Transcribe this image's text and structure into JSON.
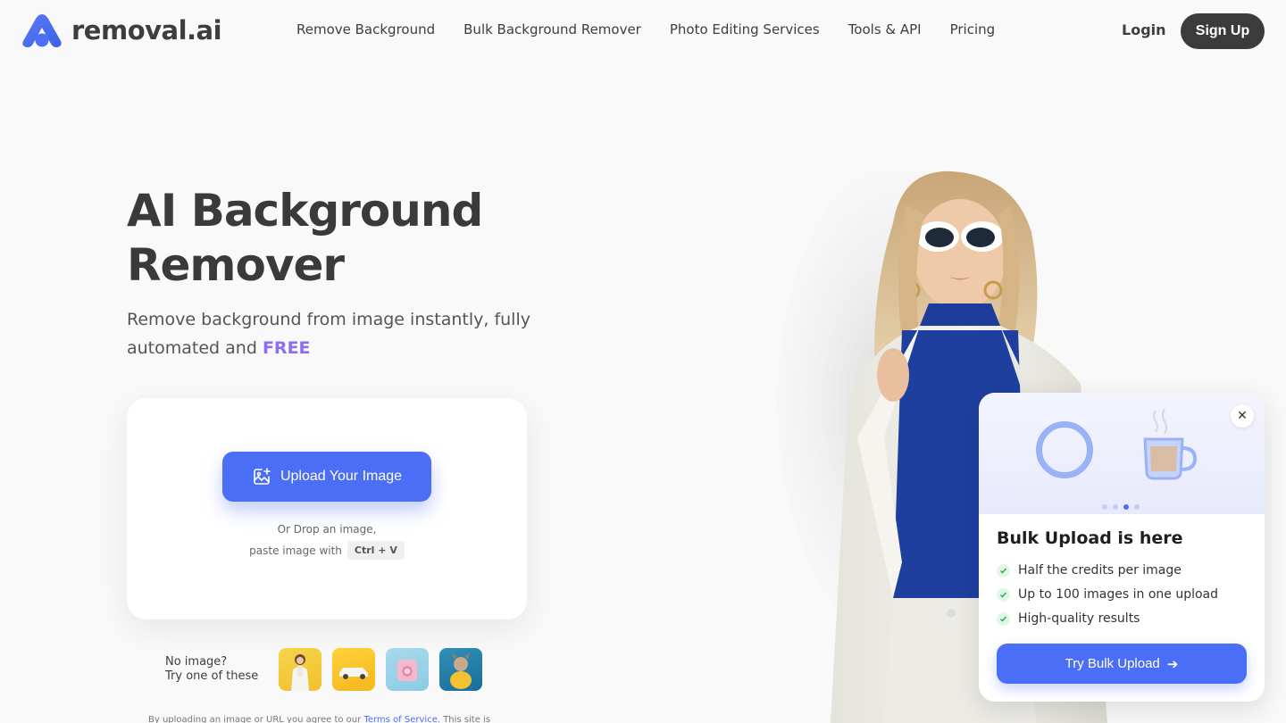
{
  "brand": {
    "name": "removal.ai",
    "logo_icon": "removal-ai-logo-icon",
    "color": "#4a6ef5"
  },
  "nav": {
    "items": [
      {
        "label": "Remove Background"
      },
      {
        "label": "Bulk Background Remover"
      },
      {
        "label": "Photo Editing Services"
      },
      {
        "label": "Tools & API"
      },
      {
        "label": "Pricing"
      }
    ],
    "login": "Login",
    "signup": "Sign Up"
  },
  "hero": {
    "title_line1": "AI Background",
    "title_line2": "Remover",
    "subtitle_prefix": "Remove background from image instantly, fully automated and",
    "subtitle_highlight": "FREE",
    "highlight_color": "#8f6cf0"
  },
  "upload": {
    "button_label": "Upload Your Image",
    "button_icon": "image-upload-icon",
    "drop_text": "Or Drop an image,",
    "paste_text": "paste image with",
    "shortcut": "Ctrl + V"
  },
  "samples": {
    "label_line1": "No image?",
    "label_line2": "Try one of these",
    "thumbnails": [
      "sample-woman",
      "sample-car",
      "sample-camera",
      "sample-dog"
    ]
  },
  "terms": {
    "prefix": "By uploading an image or URL you agree to our",
    "link": "Terms of Service",
    "suffix": ". This site is"
  },
  "popup": {
    "title": "Bulk Upload is here",
    "features": [
      "Half the credits per image",
      "Up to 100 images in one upload",
      "High-quality results"
    ],
    "cta": "Try Bulk Upload",
    "close_icon": "close-icon",
    "slide_count": 4,
    "active_slide": 3
  }
}
